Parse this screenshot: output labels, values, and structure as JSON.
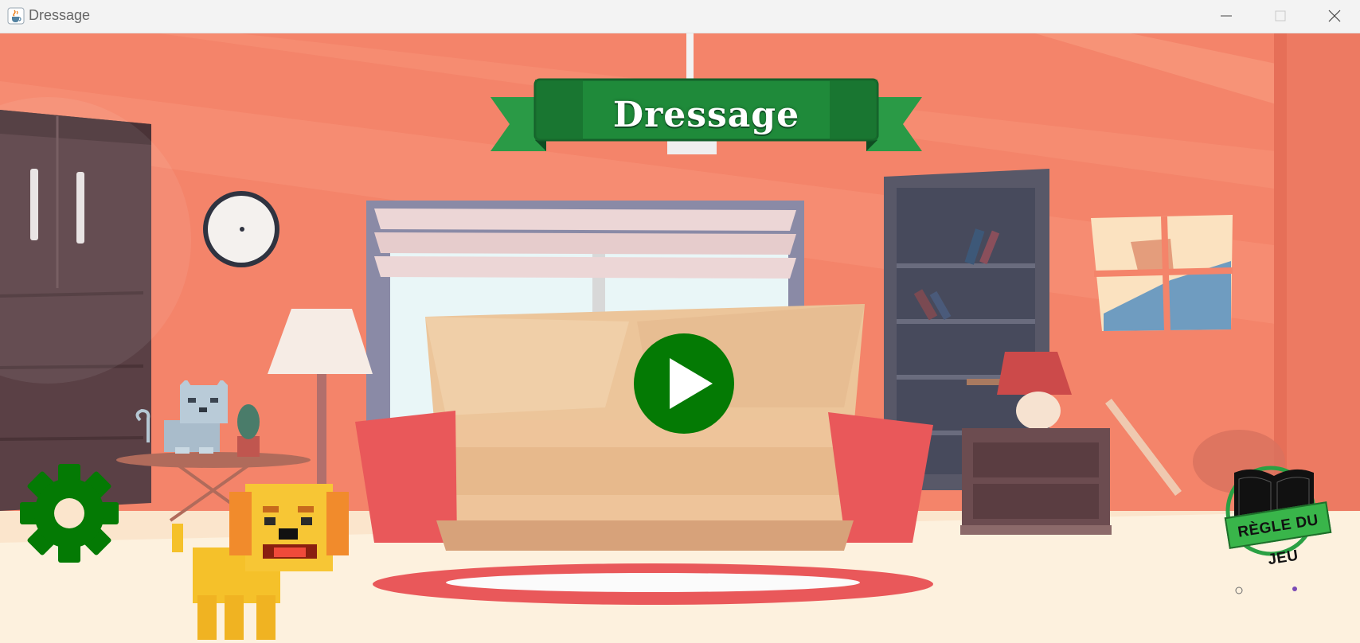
{
  "window": {
    "title": "Dressage",
    "controls": [
      "minimize",
      "maximize",
      "close"
    ],
    "app_icon": "java-cup-icon"
  },
  "game": {
    "banner_title": "Dressage",
    "play_button_icon": "play-icon",
    "settings_button_icon": "gear-icon",
    "rules_button": {
      "icon": "open-book-icon",
      "label": "RÈGLE DU JEU"
    },
    "characters": [
      "cat",
      "dog"
    ],
    "colors": {
      "banner_green": "#1f8a3a",
      "button_green": "#047a04",
      "wall_orange": "#f4846a"
    }
  }
}
